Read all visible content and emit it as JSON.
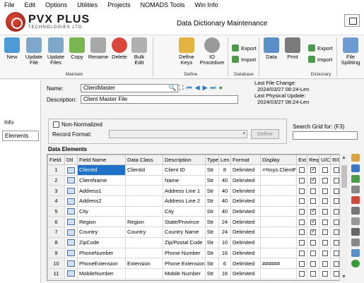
{
  "menu": [
    "File",
    "Edit",
    "Options",
    "Utilities",
    "Projects",
    "NOMADS Tools",
    "Win Info"
  ],
  "header": {
    "logo_main": "PVX PLUS",
    "logo_sub": "TECHNOLOGIES LTD.",
    "title": "Data Dictionary Maintenance"
  },
  "ribbon": {
    "buttons": {
      "new": "New",
      "update_file": "Update File",
      "update_files": "Update Files",
      "copy": "Copy",
      "rename": "Rename",
      "delete": "Delete",
      "bulk_edit": "Bulk Edit",
      "define_keys": "Define Keys",
      "io_procedure": "IO Procedure",
      "export": "Export",
      "import": "Import",
      "data": "Data",
      "print": "Print",
      "export2": "Export",
      "import2": "Import",
      "file_splitting": "File Splitting"
    },
    "groups": {
      "maintain": "Maintain",
      "define": "Define",
      "database": "Database",
      "dictionary": "Dictionary"
    }
  },
  "left_tabs": {
    "info": "Info",
    "elements": "Elements"
  },
  "form": {
    "name_label": "Name:",
    "name_value": "ClientMaster",
    "desc_label": "Description:",
    "desc_value": "Client Master File",
    "last_file_change_label": "Last File Change:",
    "last_file_change_value": "2024/03/27 08:24-Len",
    "last_physical_label": "Last Physical Update:",
    "last_physical_value": "2024/03/27 08:24-Len",
    "non_normalized": "Non-Normalized",
    "record_format": "Record Format:",
    "define_btn": "Define",
    "search_grid": "Search Grid for: (F3)"
  },
  "grid": {
    "title": "Data Elements",
    "columns": [
      "Field",
      "Dtl",
      "Field Name",
      "Data Class",
      "Description",
      "Type",
      "Len",
      "Format",
      "Display",
      "Ext",
      "Req",
      "U/C",
      "R/O"
    ],
    "rows": [
      {
        "field": "1",
        "name": "ClientId",
        "cls": "Clientid",
        "desc": "Client ID",
        "type": "Str",
        "len": "8",
        "format": "Delimited",
        "display": "=%sys.ClientF",
        "req": true
      },
      {
        "field": "2",
        "name": "ClientName",
        "cls": "",
        "desc": "Name",
        "type": "Str",
        "len": "40",
        "format": "Delimited",
        "display": "",
        "req": true
      },
      {
        "field": "3",
        "name": "Address1",
        "cls": "",
        "desc": "Address Line 1",
        "type": "Str",
        "len": "40",
        "format": "Delimited",
        "display": "",
        "req": false
      },
      {
        "field": "4",
        "name": "Address2",
        "cls": "",
        "desc": "Address Line 2",
        "type": "Str",
        "len": "40",
        "format": "Delimited",
        "display": "",
        "req": false
      },
      {
        "field": "5",
        "name": "City",
        "cls": "",
        "desc": "City",
        "type": "Str",
        "len": "40",
        "format": "Delimited",
        "display": "",
        "req": true
      },
      {
        "field": "6",
        "name": "Region",
        "cls": "Region",
        "desc": "State/Province",
        "type": "Str",
        "len": "24",
        "format": "Delimited",
        "display": "",
        "req": true
      },
      {
        "field": "7",
        "name": "Country",
        "cls": "Country",
        "desc": "Country Name",
        "type": "Str",
        "len": "24",
        "format": "Delimited",
        "display": "",
        "req": true
      },
      {
        "field": "8",
        "name": "ZipCode",
        "cls": "",
        "desc": "Zip/Postal Code",
        "type": "Str",
        "len": "10",
        "format": "Delimited",
        "display": "",
        "req": false
      },
      {
        "field": "9",
        "name": "PhoneNumber",
        "cls": "",
        "desc": "Phone Number",
        "type": "Str",
        "len": "16",
        "format": "Delimited",
        "display": "",
        "req": false
      },
      {
        "field": "10",
        "name": "PhoneExtension",
        "cls": "Extension",
        "desc": "Phone Extension",
        "type": "Str",
        "len": "6",
        "format": "Delimited",
        "display": "######",
        "req": false
      },
      {
        "field": "11",
        "name": "MobileNumber",
        "cls": "",
        "desc": "Mobile Number",
        "type": "Str",
        "len": "16",
        "format": "Delimited",
        "display": "",
        "req": false
      }
    ]
  }
}
